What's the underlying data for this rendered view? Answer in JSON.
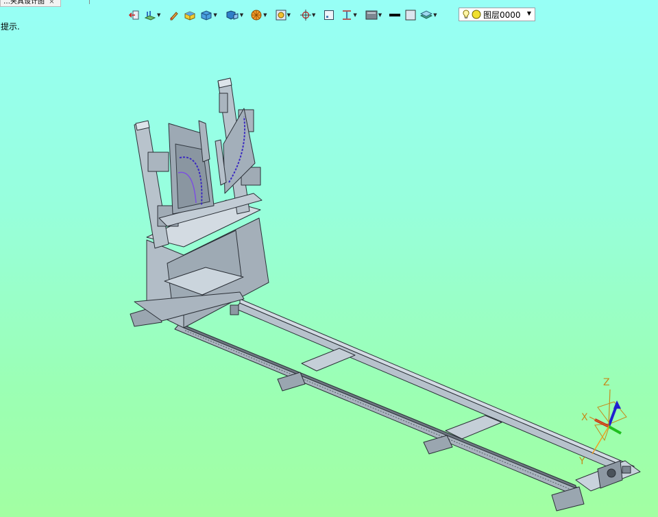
{
  "document_tab": {
    "title": "…夹具设计图",
    "close": "×"
  },
  "hint": "提示.",
  "toolbar": {
    "buttons": [
      {
        "name": "exit-sketch-icon"
      },
      {
        "name": "plane-icon",
        "dropdown": true
      },
      {
        "name": "edit-icon"
      },
      {
        "name": "solid-icon"
      },
      {
        "name": "box-icon",
        "dropdown": true
      },
      {
        "name": "view-orient-icon",
        "dropdown": true
      },
      {
        "name": "render-style-icon",
        "dropdown": true
      },
      {
        "name": "zoom-icon",
        "dropdown": true
      },
      {
        "name": "origin-icon",
        "dropdown": true
      },
      {
        "name": "frame-icon"
      },
      {
        "name": "dimension-icon",
        "dropdown": true
      },
      {
        "name": "display-icon",
        "dropdown": true
      },
      {
        "name": "line-color-icon"
      },
      {
        "name": "fill-icon"
      },
      {
        "name": "layer-stack-icon",
        "dropdown": true
      }
    ],
    "layer": {
      "label": "图层0000",
      "arrow": "▼"
    }
  },
  "triad": {
    "x_label": "X",
    "y_label": "Y",
    "z_label": "Z"
  },
  "colors": {
    "bg_top": "#97fff6",
    "bg_bottom": "#a2ffa2",
    "steel": "#b7c2cc",
    "edge": "#2a2f36",
    "axis_label": "#c58a1a"
  }
}
